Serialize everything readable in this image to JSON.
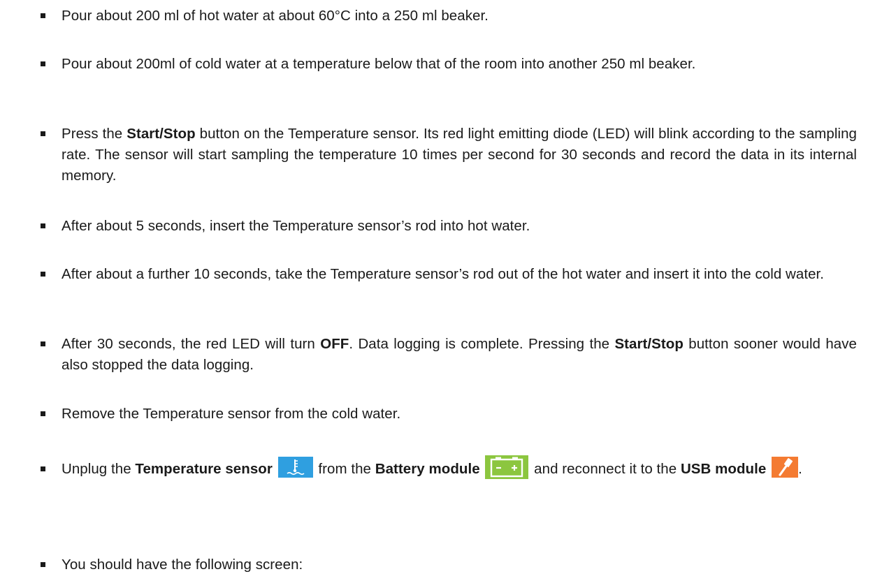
{
  "colors": {
    "text": "#1a1a1a",
    "temperature_icon_bg": "#2f9fe0",
    "battery_icon_bg": "#8cc63f",
    "usb_icon_bg": "#f47b32"
  },
  "icons": {
    "temperature": "temperature-sensor-icon",
    "battery": "battery-module-icon",
    "usb": "usb-module-icon"
  },
  "steps": {
    "s1": {
      "text": "Pour about 200 ml of hot water at about 60°C into a 250 ml beaker."
    },
    "s2": {
      "text": "Pour about 200ml of cold water at a temperature below that of the room into another 250 ml beaker."
    },
    "s3": {
      "pre": "Press the ",
      "bold": "Start/Stop",
      "post": " button on the Temperature sensor. Its red light emitting diode (LED) will blink according to the sampling rate. The sensor will start sampling the temperature 10 times per second for 30 seconds and record the data in its internal memory."
    },
    "s4": {
      "text": "After about 5 seconds, insert the Temperature sensor’s rod into hot water."
    },
    "s5": {
      "text": "After about a further 10 seconds, take the Temperature sensor’s rod out of the hot water and insert it into the cold water."
    },
    "s6": {
      "pre": "After 30 seconds, the red LED will turn ",
      "bold1": "OFF",
      "mid": ". Data logging is complete. Pressing the ",
      "bold2": "Start/Stop",
      "post": " button sooner would have also stopped the data logging."
    },
    "s7": {
      "text": "Remove the Temperature sensor from the cold water."
    },
    "s8": {
      "pre": "Unplug the ",
      "bold1": "Temperature sensor",
      "mid1": " from the ",
      "bold2": "Battery module",
      "mid2": " and reconnect it to the ",
      "bold3": "USB module",
      "post": "."
    },
    "s9": {
      "text": "You should have the following screen:"
    }
  }
}
